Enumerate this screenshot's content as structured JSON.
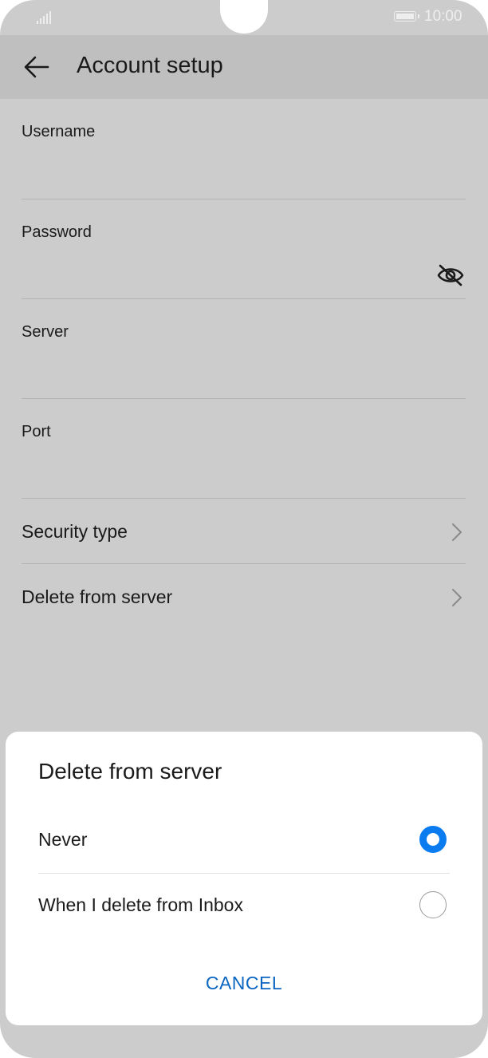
{
  "status_bar": {
    "time": "10:00",
    "signal_icon": "signal-bars-icon",
    "battery_icon": "battery-icon"
  },
  "app_bar": {
    "back_icon": "arrow-left-icon",
    "title": "Account setup"
  },
  "form": {
    "fields": [
      {
        "label": "Username",
        "value": ""
      },
      {
        "label": "Password",
        "value": "",
        "toggle_icon": "eye-off-icon"
      },
      {
        "label": "Server",
        "value": ""
      },
      {
        "label": "Port",
        "value": ""
      }
    ],
    "rows": [
      {
        "label": "Security type",
        "icon": "chevron-right-icon"
      },
      {
        "label": "Delete from server",
        "icon": "chevron-right-icon"
      }
    ]
  },
  "dialog": {
    "title": "Delete from server",
    "options": [
      {
        "label": "Never",
        "selected": true
      },
      {
        "label": "When I delete from Inbox",
        "selected": false
      }
    ],
    "cancel_label": "CANCEL",
    "accent_color": "#0a7cf0",
    "cancel_color": "#0a66c2"
  },
  "colors": {
    "scrim_background": "#cccccc",
    "app_bar": "#bfbfbf"
  }
}
